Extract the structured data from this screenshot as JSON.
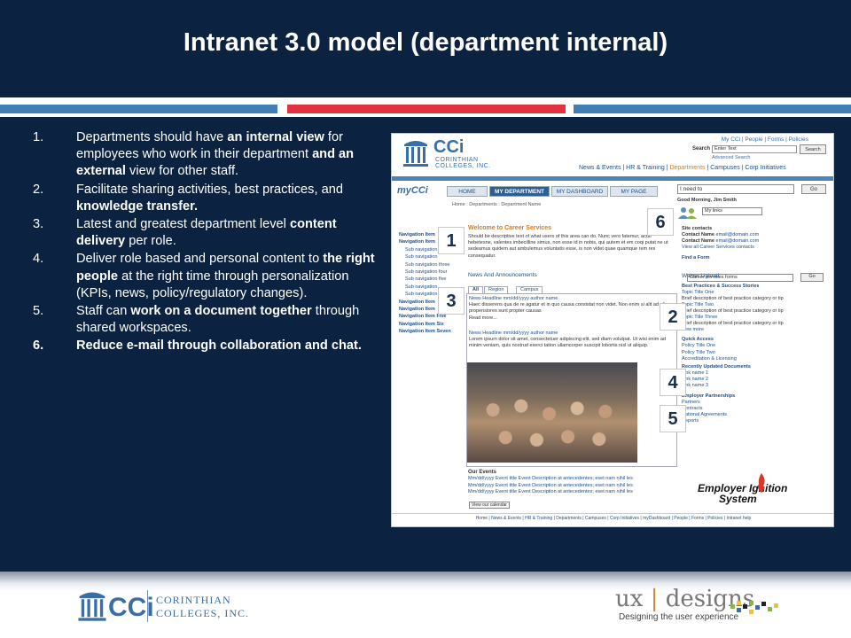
{
  "slide": {
    "title": "Intranet 3.0 model (department internal)"
  },
  "bullets": [
    {
      "num": "1.",
      "parts": [
        [
          "Departments should have ",
          false
        ],
        [
          "an internal view",
          true
        ],
        [
          " for employees who work in their department ",
          false
        ],
        [
          "and an external",
          true
        ],
        [
          " view for other staff.",
          false
        ]
      ]
    },
    {
      "num": "2.",
      "parts": [
        [
          "Facilitate sharing activities, best practices, and ",
          false
        ],
        [
          "knowledge transfer.",
          true
        ]
      ]
    },
    {
      "num": "3.",
      "parts": [
        [
          "Latest and greatest department level ",
          false
        ],
        [
          "content delivery",
          true
        ],
        [
          " per role.",
          false
        ]
      ]
    },
    {
      "num": "4.",
      "parts": [
        [
          "Deliver role based and personal content to ",
          false
        ],
        [
          "the right people",
          true
        ],
        [
          " at the right time through personalization (KPIs, news, policy/regulatory changes).",
          false
        ]
      ]
    },
    {
      "num": "5.",
      "parts": [
        [
          "Staff can ",
          false
        ],
        [
          "work on a document together",
          true
        ],
        [
          " through shared workspaces.",
          false
        ]
      ]
    },
    {
      "num": "6.",
      "bold": true,
      "parts": [
        [
          "Reduce e-mail",
          true
        ],
        [
          " through collaboration and chat.",
          false
        ]
      ]
    }
  ],
  "mock": {
    "logo_cci": "CCi",
    "logo_sub": "CORINTHIAN\nCOLLEGES, INC.",
    "util_links": "My CCi | People | Forms | Policies",
    "search_label": "Search",
    "search_placeholder": "Enter Text",
    "search_button": "Search",
    "advanced_search": "Advanced Search",
    "topnav_before": "News & Events | HR & Training | ",
    "topnav_active": "Departments",
    "topnav_after": " | Campuses | Corp Initiatives",
    "mycci": "myCCi",
    "tabs": [
      "HOME",
      "MY DEPARTMENT",
      "MY DASHBOARD",
      "MY PAGE"
    ],
    "ineed": "I need to",
    "go": "Go",
    "crumb": "Home : Departments : Department Name",
    "greeting": "Good Morning, Jim Smith",
    "mylinks": "My links",
    "leftnav": [
      {
        "t": "Navigation Item",
        "top": true
      },
      {
        "t": "Navigation Item",
        "top": true
      },
      {
        "t": "Sub navigation",
        "top": false
      },
      {
        "t": "Sub navigation",
        "top": false
      },
      {
        "t": "Sub navigation three",
        "top": false
      },
      {
        "t": "Sub navigation four",
        "top": false
      },
      {
        "t": "Sub navigation five",
        "top": false
      },
      {
        "t": "Sub navigation",
        "top": false
      },
      {
        "t": "Sub navigation",
        "top": false
      },
      {
        "t": "Navigation Item",
        "top": true
      },
      {
        "t": "Navigation Item",
        "top": true
      },
      {
        "t": "Navigation Item Five",
        "top": true
      },
      {
        "t": "Navigation Item Six",
        "top": true
      },
      {
        "t": "Navigation Item Seven",
        "top": true
      }
    ],
    "welcome": "Welcome to Career Services",
    "welcome_text": "Should be descriptive text of what users of this area can do. Nunc vero fatemur, acuti hebetesne, valentes imbecilline simus, non esse id in nobis, qui autem et em coqi putat ne ut sedeamus quidem aut ambulemus voluntatis esse, is non videt quae quamque rem res consequatur.",
    "news_heading": "News And Announcements",
    "news_tabs": [
      "All",
      "Region",
      "Campus"
    ],
    "news_items": [
      {
        "h": "News Headline mm/dd/yyyy author name",
        "t": "Haec disserens qua de re agatur et in quo causa consistat non videt. Non enim si alit ad alia propensiores sunt propter causas",
        "more": "Read more..."
      },
      {
        "h": "News Headline mm/dd/yyyy author name",
        "t": "Lorem ipsum dolor sit amet, consectetuer adipiscing elit, sed diam volutpat. Ut wisi enim ad minim veniam, quis nostrud exerci tation ullamcorper suscipit lobortis nisl ut aliquip.",
        "more": ""
      }
    ],
    "events_heading": "Our Events",
    "events": [
      "Mm/dd/yyyy Event title Event Description at antecedentes; eset nam nihil les",
      "Mm/dd/yyyy Event title Event Description at antecedentes; eset nam nihil les",
      "Mm/dd/yyyy Event title Event Description at antecedentes; eset nam nihil les"
    ],
    "view_calendar": "View our calendar",
    "site_contacts": "Site contacts",
    "contacts": [
      {
        "label": "Contact Name",
        "email": "email@domain.com"
      },
      {
        "label": "Contact Name",
        "email": "email@domain.com"
      }
    ],
    "view_all_contacts": "View all Career Services contacts",
    "find_form": "Find a Form",
    "form_select": "Career services forms",
    "waiver": "Waiver Upload",
    "best_practices": "Best Practices & Success Stories",
    "bp_items": [
      {
        "t": "Topic Title One",
        "link": true
      },
      {
        "t": "Brief description of best practice category or tip",
        "link": false
      },
      {
        "t": "Topic Title Two",
        "link": true
      },
      {
        "t": "Brief description of best practice category or tip",
        "link": false
      },
      {
        "t": "Topic Title Three",
        "link": true
      },
      {
        "t": "Brief description of best practice category or tip",
        "link": false
      },
      {
        "t": "view more",
        "link": true
      }
    ],
    "quick_access": "Quick Access",
    "qa_items": [
      "Policy Title One",
      "Policy Title Two",
      "Accreditation & Licensing"
    ],
    "recent_docs": "Recently Updated Documents",
    "doc_items": [
      "Link name 1",
      "Link name 2",
      "Link name 3"
    ],
    "employer": "Employer Partnerships",
    "employer_items": [
      "Partners",
      "Contracts",
      "National Agreements",
      "Reports"
    ],
    "eis_line1": "Employer Ignition",
    "eis_line2": "System",
    "footer": "Home | News & Events | HR & Training | Departments | Campuses | Corp Initiatives | myDashboard | People | Forms | Policies | Intranet help"
  },
  "badges": [
    "1",
    "3",
    "6",
    "2",
    "4",
    "5"
  ],
  "footer": {
    "cci_word": "CCi",
    "cci_name1": "CORINTHIAN",
    "cci_name2": "COLLEGES, INC.",
    "ux_left": "ux",
    "ux_pipe": "|",
    "ux_right": "designs",
    "ux_tag": "Designing the user experience"
  },
  "colors": {
    "background": "#0b2240",
    "accent_blue": "#3f7fb5",
    "accent_red": "#e2313f",
    "link_blue": "#1e4f8a",
    "orange": "#d77a1b"
  }
}
